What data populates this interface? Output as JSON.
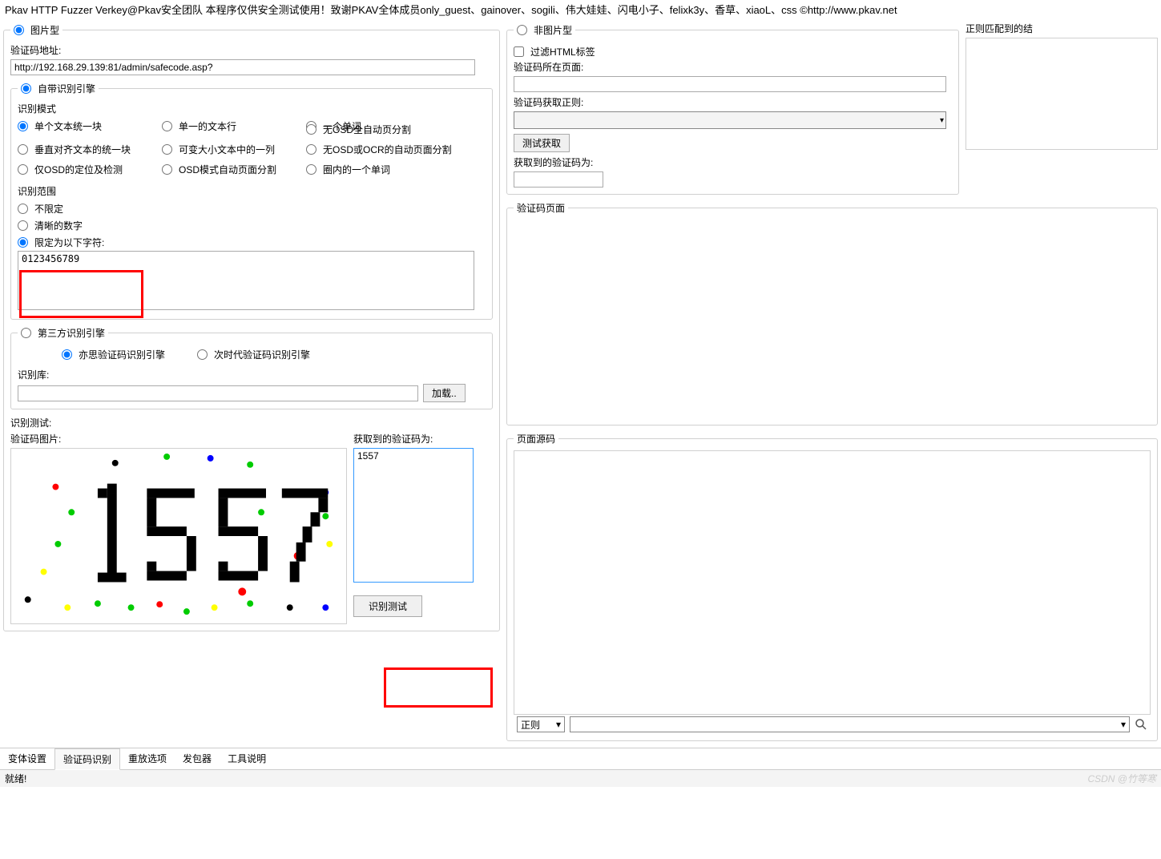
{
  "title_bar": "Pkav HTTP Fuzzer   Verkey@Pkav安全团队   本程序仅供安全测试使用！致谢PKAV全体成员only_guest、gainover、sogili、伟大娃娃、闪电小子、felixk3y、香草、xiaoL、css  ©http://www.pkav.net",
  "left": {
    "image_type_legend": "图片型",
    "addr_label": "验证码地址:",
    "addr_value": "http://192.168.29.139:81/admin/safecode.asp?",
    "builtin_legend": "自带识别引擎",
    "rec_mode_label": "识别模式",
    "modes": {
      "m1": "单个文本统一块",
      "m2": "单一的文本行",
      "m3": "一个单词",
      "m4": "无OSD全自动页分割",
      "m5": "垂直对齐文本的统一块",
      "m6": "可变大小文本中的一列",
      "m7": "无OSD或OCR的自动页面分割",
      "m8": "仅OSD的定位及检测",
      "m9": "OSD模式自动页面分割",
      "m10": "圈内的一个单词"
    },
    "range_label": "识别范围",
    "range_unlimited": "不限定",
    "range_clear": "清晰的数字",
    "range_limit_label": "限定为以下字符:",
    "range_limit_value": "0123456789",
    "third_legend": "第三方识别引擎",
    "third_opt1": "亦思验证码识别引擎",
    "third_opt2": "次时代验证码识别引擎",
    "lib_label": "识别库:",
    "load_btn": "加载..",
    "test_label": "识别测试:",
    "img_label": "验证码图片:",
    "got_label": "获取到的验证码为:",
    "got_value": "1557",
    "test_btn": "识别测试"
  },
  "right": {
    "nonimg_legend": "非图片型",
    "filter_html": "过滤HTML标签",
    "page_label": "验证码所在页面:",
    "regex_label": "验证码获取正则:",
    "regex_result_label": "正则匹配到的结",
    "test_get_btn": "测试获取",
    "got_label": "获取到的验证码为:",
    "page_fieldset": "验证码页面",
    "src_fieldset": "页面源码",
    "regex_dropdown": "正则"
  },
  "tabs": [
    "变体设置",
    "验证码识别",
    "重放选项",
    "发包器",
    "工具说明"
  ],
  "status": "就绪!",
  "watermark": "CSDN @竹等寒"
}
